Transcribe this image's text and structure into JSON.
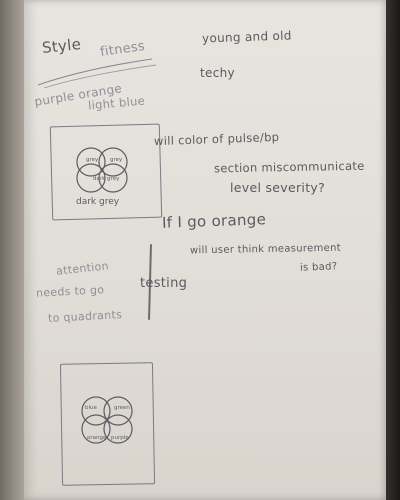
{
  "notes": {
    "style": "Style",
    "fitness": "fitness",
    "young_old": "young and old",
    "techy": "techy",
    "colors_1": "purple orange",
    "colors_2": "light blue",
    "question_1_l1": "will color of pulse/bp",
    "question_1_l2": "section miscommunicate",
    "question_1_l3": "level severity?",
    "question_2_l1": "If I go orange",
    "question_2_l2": "will user think measurement",
    "question_2_l3": "is bad?",
    "attention_l1": "attention",
    "attention_l2": "needs to go",
    "attention_l3": "to quadrants",
    "testing": "testing"
  },
  "sketch_1": {
    "labels": [
      "grey",
      "grey",
      "dark grey"
    ],
    "caption": "dark grey"
  },
  "sketch_2": {
    "labels": [
      "blue",
      "green",
      "orange",
      "purple"
    ]
  },
  "colors": {
    "paper": "#e4e0db",
    "pencil": "#5a5a5e"
  }
}
